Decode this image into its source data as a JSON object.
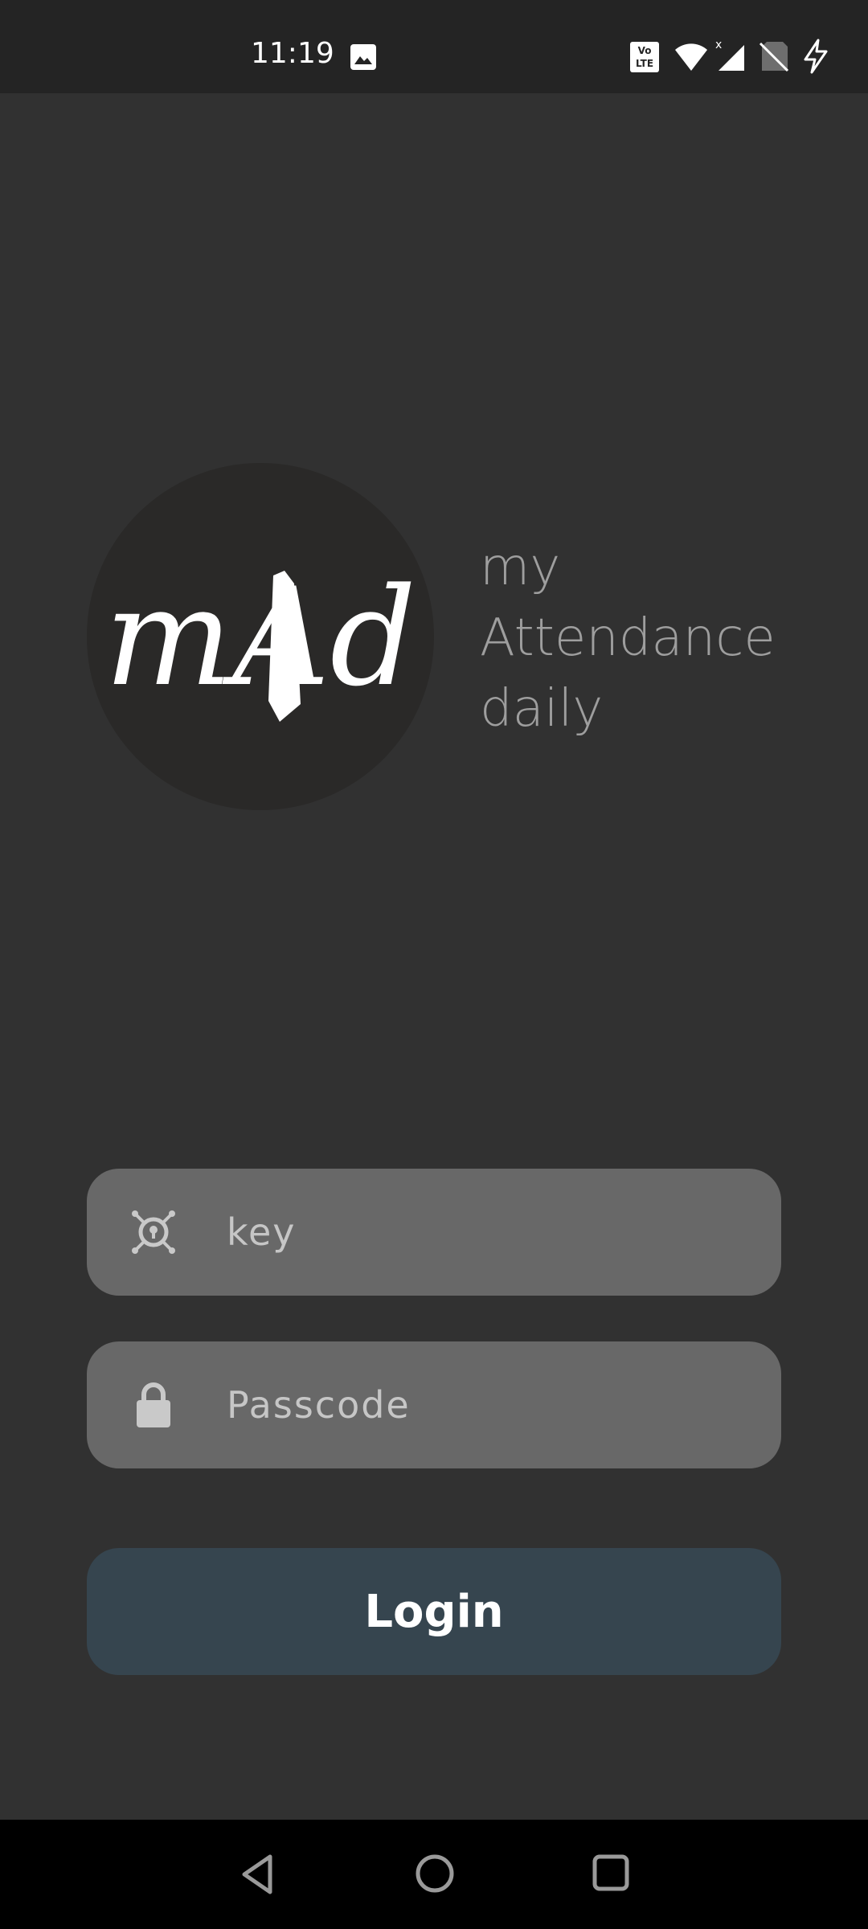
{
  "status_bar": {
    "time": "11:19",
    "volte_label": "Vo LTE",
    "icons": [
      "gallery-icon",
      "volte-icon",
      "wifi-icon",
      "signal-icon",
      "no-sim-icon",
      "charging-icon"
    ]
  },
  "logo": {
    "text": "mAd"
  },
  "app_name": {
    "line1": "my",
    "line2": "Attendance",
    "line3": "daily"
  },
  "form": {
    "key_placeholder": "key",
    "passcode_placeholder": "Passcode",
    "login_label": "Login"
  },
  "colors": {
    "background": "#313131",
    "status_bar": "#242424",
    "field": "#686868",
    "button": "#36454f",
    "logo_circle": "#2a2928"
  }
}
